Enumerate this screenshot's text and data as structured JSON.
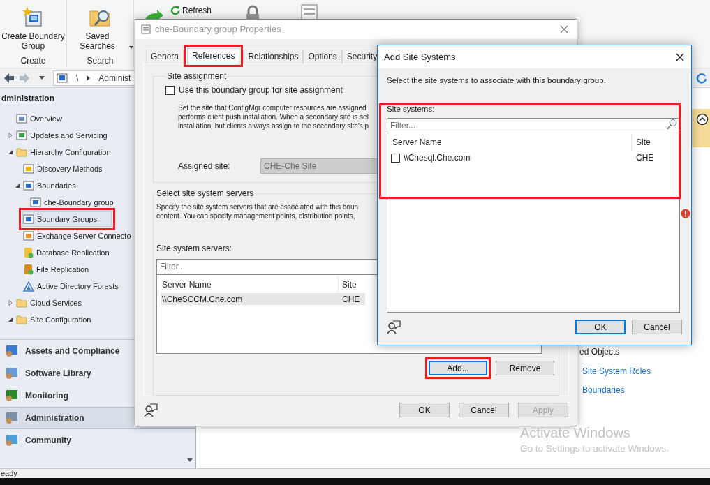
{
  "ribbon": {
    "groups": [
      {
        "kind": "create",
        "button": "Create Boundary Group",
        "label": "Create",
        "dropdown": false
      },
      {
        "kind": "search",
        "button": "Saved Searches",
        "label": "Search",
        "dropdown": true
      }
    ],
    "refresh": "Refresh"
  },
  "nav": {
    "path": [
      "\\",
      "Administ"
    ]
  },
  "tree": {
    "header": "dministration",
    "items": [
      {
        "label": "Overview",
        "kind": "overview",
        "selected": false
      },
      {
        "label": "Updates and Servicing",
        "kind": "updates",
        "selected": false,
        "expanded": false
      },
      {
        "label": "Hierarchy Configuration",
        "kind": "folder",
        "selected": false,
        "expanded": true,
        "children": [
          {
            "label": "Discovery Methods",
            "kind": "discovery",
            "selected": false
          },
          {
            "label": "Boundaries",
            "kind": "node",
            "selected": false,
            "expanded": true,
            "children": [
              {
                "label": "che-Boundary group",
                "kind": "node",
                "selected": false
              }
            ]
          },
          {
            "label": "Boundary Groups",
            "kind": "node",
            "selected": true,
            "highlighted": true
          },
          {
            "label": "Exchange Server Connecto",
            "kind": "exchange",
            "selected": false
          },
          {
            "label": "Database Replication",
            "kind": "database",
            "selected": false
          },
          {
            "label": "File Replication",
            "kind": "file",
            "selected": false
          },
          {
            "label": "Active Directory Forests",
            "kind": "forest",
            "selected": false
          }
        ]
      },
      {
        "label": "Cloud Services",
        "kind": "folder",
        "selected": false,
        "expanded": false
      },
      {
        "label": "Site Configuration",
        "kind": "folder",
        "selected": false,
        "expanded": true
      }
    ]
  },
  "workspaces": [
    {
      "label": "Assets and Compliance",
      "kind": "assets",
      "selected": false
    },
    {
      "label": "Software Library",
      "kind": "library",
      "selected": false
    },
    {
      "label": "Monitoring",
      "kind": "monitoring",
      "selected": false
    },
    {
      "label": "Administration",
      "kind": "admin",
      "selected": true
    },
    {
      "label": "Community",
      "kind": "community",
      "selected": false
    }
  ],
  "right_pane": {
    "related_heading": "ed Objects",
    "links": [
      "Site System Roles",
      "Boundaries"
    ]
  },
  "properties": {
    "title": "che-Boundary group Properties",
    "tabs": [
      {
        "label": "Genera",
        "selected": false
      },
      {
        "label": "References",
        "selected": true,
        "highlighted": true
      },
      {
        "label": "Relationships",
        "selected": false
      },
      {
        "label": "Options",
        "selected": false
      },
      {
        "label": "Security",
        "selected": false
      }
    ],
    "site_assignment": {
      "heading": "Site assignment",
      "checkbox": {
        "label": "Use this boundary group for site assignment",
        "checked": false
      },
      "description_lines": [
        "Set the site that ConfigMgr computer resources are assigned",
        "performs client push installation. When a secondary site is sel",
        "installation, but clients always assign to the secondary site's p"
      ],
      "assigned_site": {
        "label": "Assigned site:",
        "value": "CHE-Che Site",
        "disabled": true
      }
    },
    "servers": {
      "heading": "Select site system servers",
      "description_lines": [
        "Specify the site system servers that are associated with this boun",
        "content. You can specify management points, distribution points,"
      ],
      "list_label": "Site system servers:",
      "filter_placeholder": "Filter...",
      "columns": [
        "Server Name",
        "Site"
      ],
      "rows": [
        {
          "cells": [
            "\\\\CheSCCM.Che.com",
            "CHE"
          ],
          "selected": true
        }
      ],
      "buttons": [
        {
          "label": "Add...",
          "highlighted": true,
          "focused": true
        },
        {
          "label": "Remove",
          "highlighted": false,
          "focused": false
        }
      ]
    },
    "footer": [
      {
        "label": "OK",
        "disabled": false
      },
      {
        "label": "Cancel",
        "disabled": false
      },
      {
        "label": "Apply",
        "disabled": true
      }
    ]
  },
  "add_dialog": {
    "title": "Add Site Systems",
    "instruction": "Select the site systems to associate with this boundary group.",
    "list_label": "Site systems:",
    "filter_placeholder": "Filter...",
    "highlighted": true,
    "columns": [
      "Server Name",
      "Site"
    ],
    "rows": [
      {
        "cells": [
          "\\\\Chesql.Che.com",
          "CHE"
        ],
        "checked": false
      }
    ],
    "buttons": [
      {
        "label": "OK",
        "focused": true
      },
      {
        "label": "Cancel",
        "focused": false
      }
    ]
  },
  "watermark": {
    "title": "Activate Windows",
    "subtitle": "Go to Settings to activate Windows."
  },
  "status_bar": "eady"
}
